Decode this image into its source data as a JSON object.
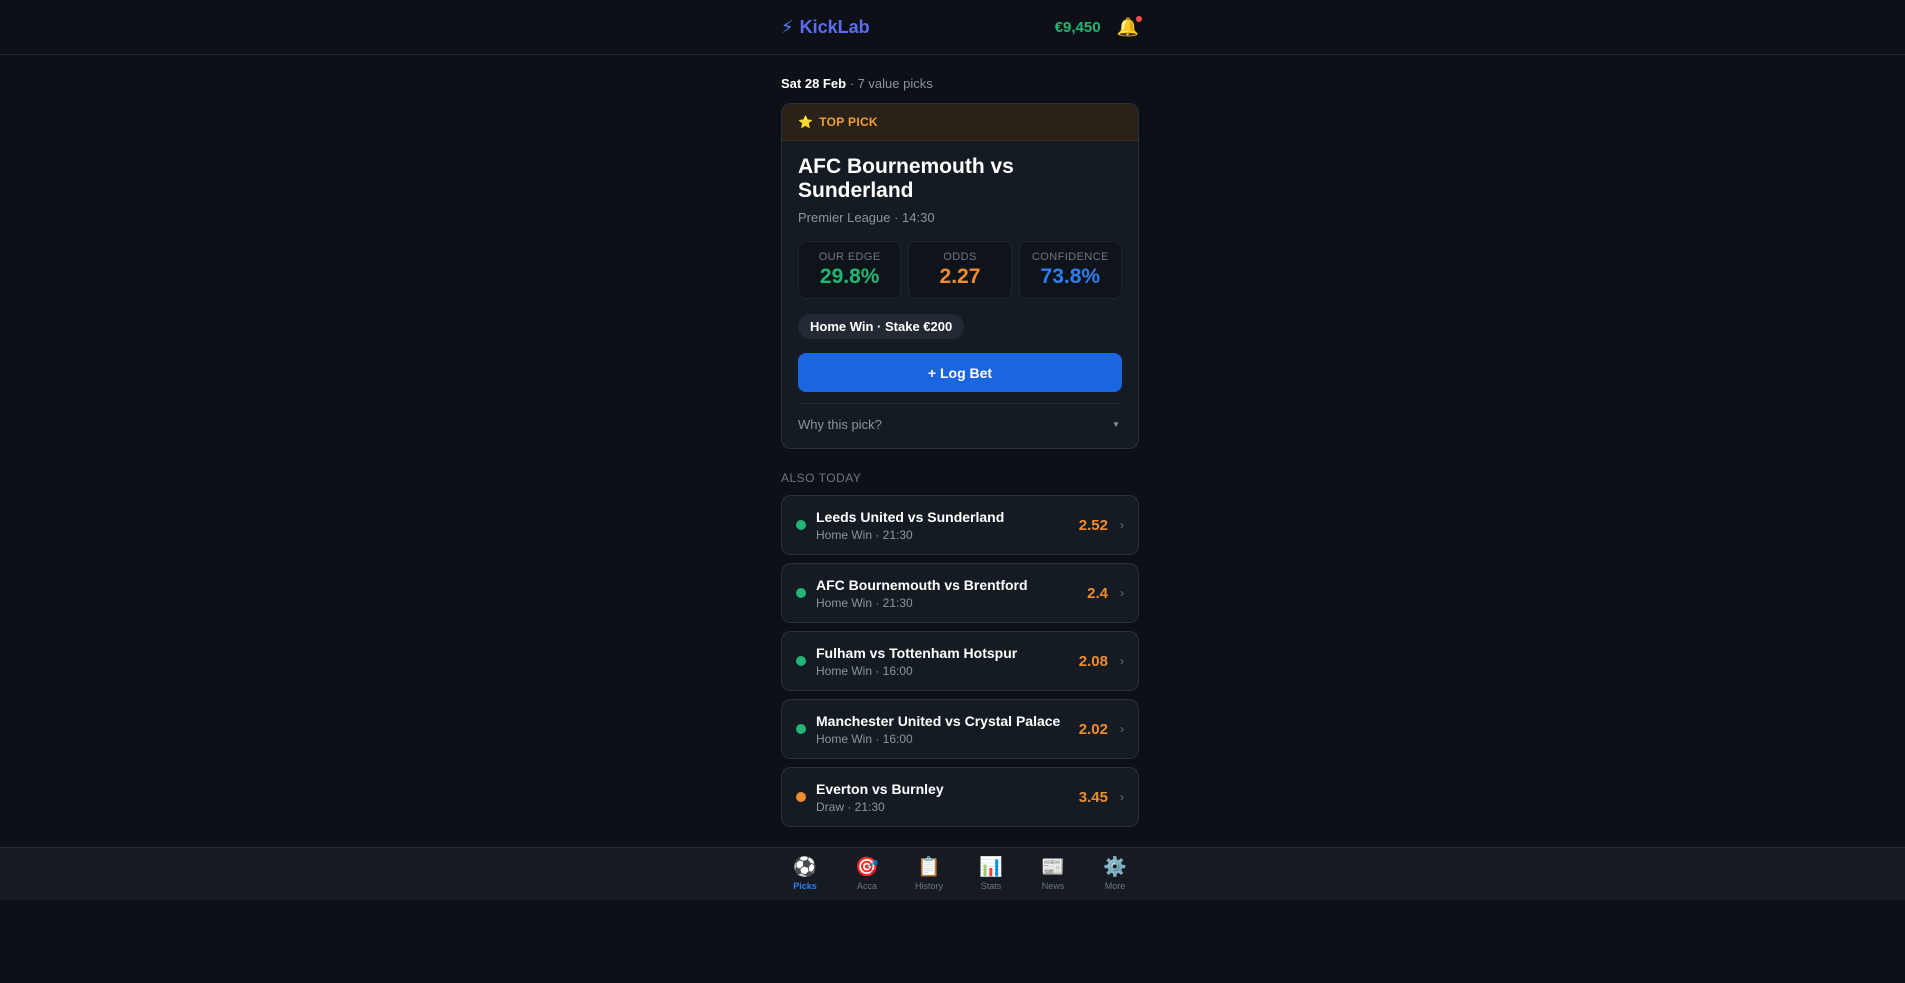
{
  "header": {
    "brand": "KickLab",
    "balance": "€9,450"
  },
  "dateline": {
    "date": "Sat 28 Feb",
    "summary": " · 7 value picks"
  },
  "top_pick": {
    "badge": "TOP PICK",
    "title": "AFC Bournemouth vs Sunderland",
    "meta": "Premier League · 14:30",
    "stats": {
      "edge_label": "OUR EDGE",
      "edge_value": "29.8%",
      "odds_label": "ODDS",
      "odds_value": "2.27",
      "conf_label": "CONFIDENCE",
      "conf_value": "73.8%"
    },
    "pill": "Home Win · Stake €200",
    "log_button": "+ Log Bet",
    "why": "Why this pick?"
  },
  "also_today_label": "ALSO TODAY",
  "picks": [
    {
      "name": "Leeds United vs Sunderland",
      "sub": "Home Win · 21:30",
      "odds": "2.52",
      "color": "#22b573"
    },
    {
      "name": "AFC Bournemouth vs Brentford",
      "sub": "Home Win · 21:30",
      "odds": "2.4",
      "color": "#22b573"
    },
    {
      "name": "Fulham vs Tottenham Hotspur",
      "sub": "Home Win · 16:00",
      "odds": "2.08",
      "color": "#22b573"
    },
    {
      "name": "Manchester United vs Crystal Palace",
      "sub": "Home Win · 16:00",
      "odds": "2.02",
      "color": "#22b573"
    },
    {
      "name": "Everton vs Burnley",
      "sub": "Draw · 21:30",
      "odds": "3.45",
      "color": "#f08c2e"
    }
  ],
  "nav": [
    {
      "label": "Picks",
      "icon": "⚽"
    },
    {
      "label": "Acca",
      "icon": "🎯"
    },
    {
      "label": "History",
      "icon": "📋"
    },
    {
      "label": "Stats",
      "icon": "📊"
    },
    {
      "label": "News",
      "icon": "📰"
    },
    {
      "label": "More",
      "icon": "⚙️"
    }
  ]
}
